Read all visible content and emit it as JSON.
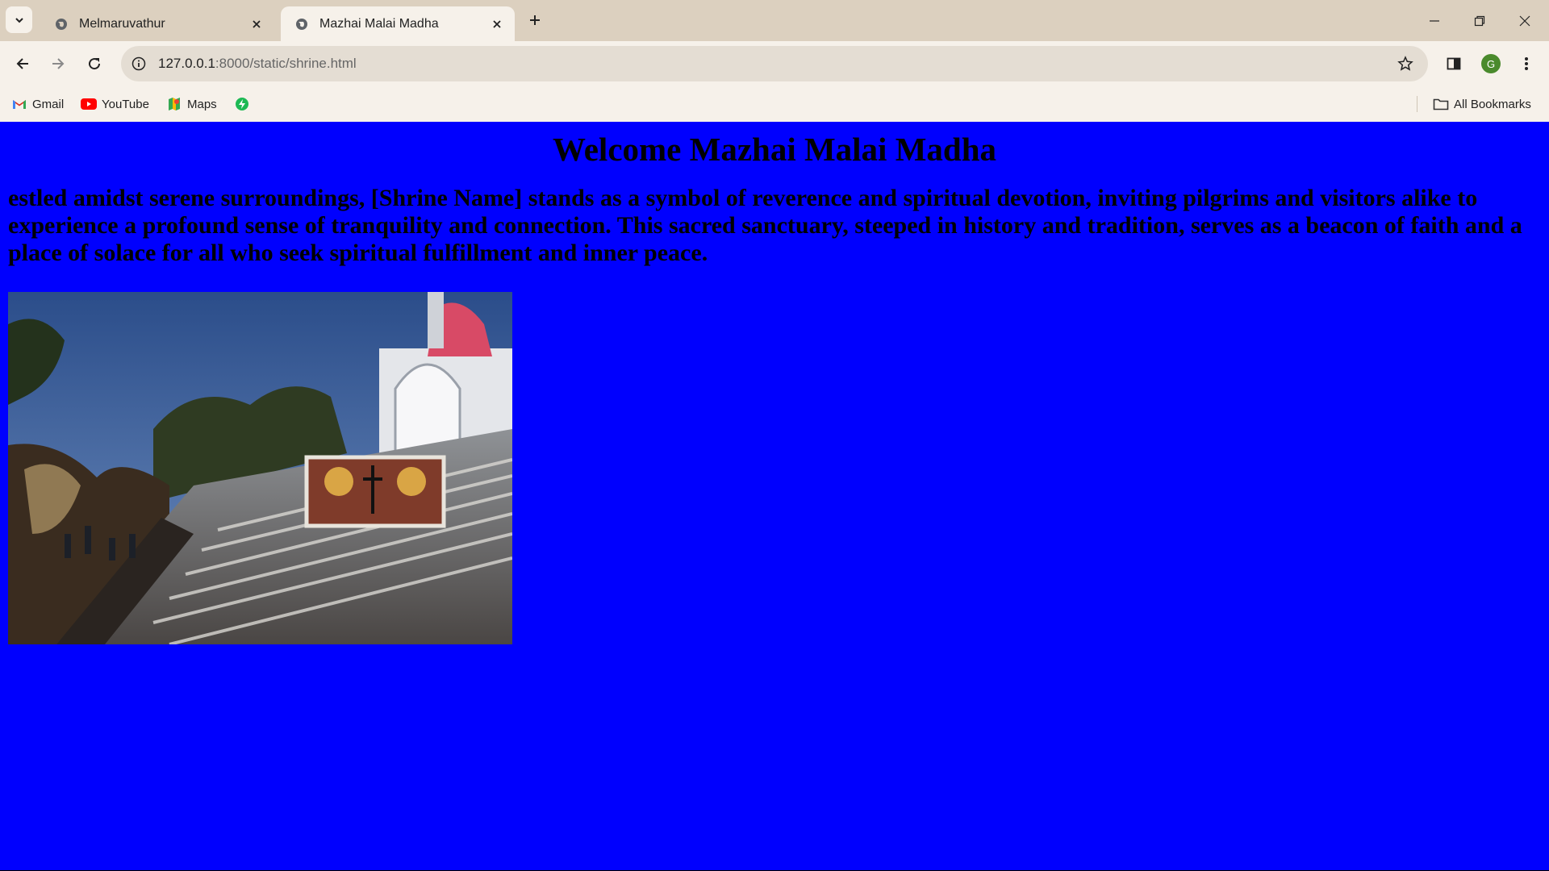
{
  "tabs": [
    {
      "title": "Melmaruvathur",
      "active": false
    },
    {
      "title": "Mazhai Malai Madha",
      "active": true
    }
  ],
  "address": {
    "host": "127.0.0.1",
    "path": ":8000/static/shrine.html"
  },
  "bookmarks": [
    {
      "label": "Gmail",
      "icon": "gmail-icon"
    },
    {
      "label": "YouTube",
      "icon": "youtube-icon"
    },
    {
      "label": "Maps",
      "icon": "maps-icon"
    },
    {
      "label": "",
      "icon": "extension-icon"
    }
  ],
  "all_bookmarks_label": "All Bookmarks",
  "profile_initial": "G",
  "page": {
    "title": "Welcome Mazhai Malai Madha",
    "description": "estled amidst serene surroundings, [Shrine Name] stands as a symbol of reverence and spiritual devotion, inviting pilgrims and visitors alike to experience a profound sense of tranquility and connection. This sacred sanctuary, steeped in history and tradition, serves as a beacon of faith and a place of solace for all who seek spiritual fulfillment and inner peace.",
    "background_color": "#0000fe"
  }
}
